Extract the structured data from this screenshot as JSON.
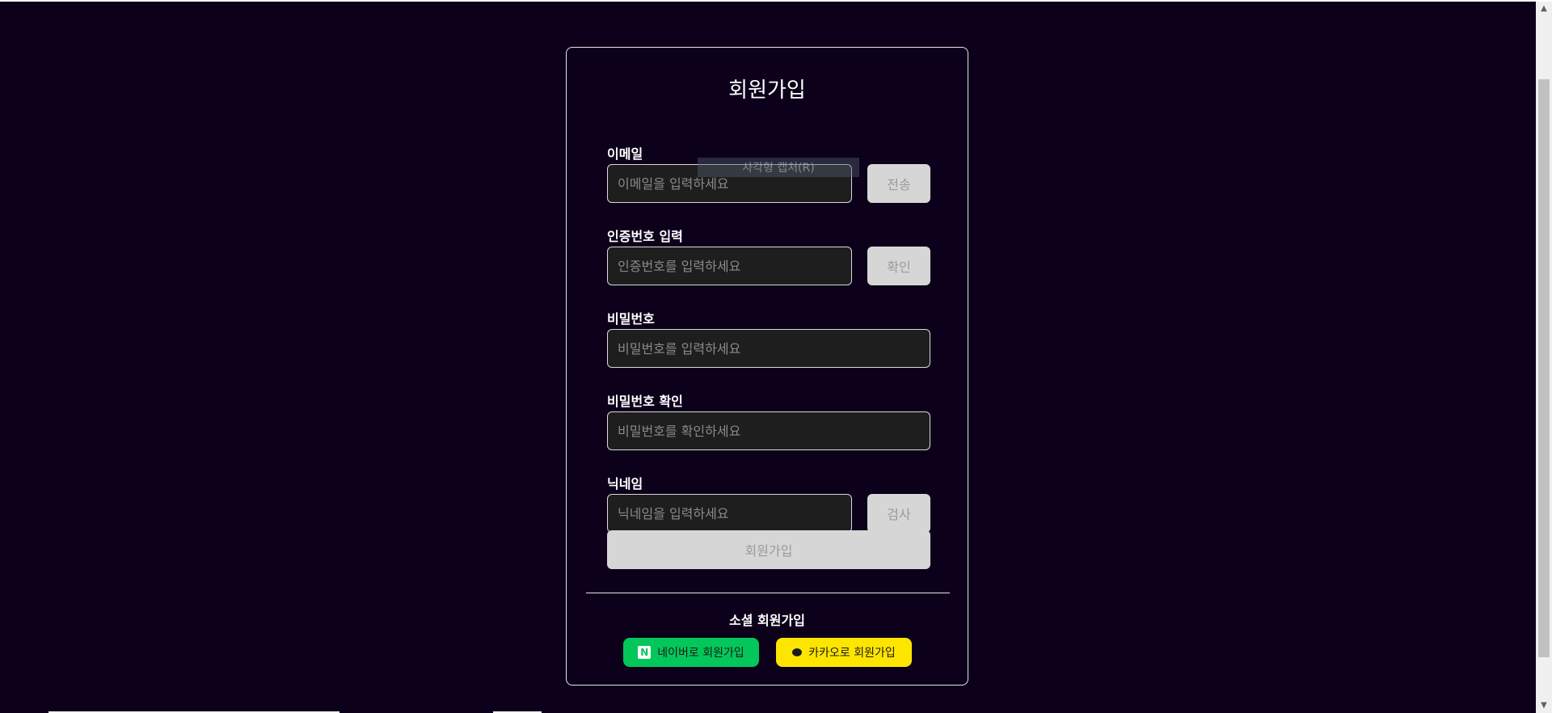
{
  "form": {
    "title": "회원가입",
    "email": {
      "label": "이메일",
      "placeholder": "이메일을 입력하세요",
      "button": "전송"
    },
    "verification": {
      "label": "인증번호 입력",
      "placeholder": "인증번호를 입력하세요",
      "button": "확인"
    },
    "password": {
      "label": "비밀번호",
      "placeholder": "비밀번호를 입력하세요"
    },
    "password_confirm": {
      "label": "비밀번호 확인",
      "placeholder": "비밀번호를 확인하세요"
    },
    "nickname": {
      "label": "닉네임",
      "placeholder": "닉네임을 입력하세요",
      "button": "검사"
    },
    "submit": "회원가입"
  },
  "social": {
    "title": "소셜 회원가입",
    "naver_label": "네이버로 회원가입",
    "naver_icon_text": "N",
    "kakao_label": "카카오로 회원가입"
  },
  "overlay": {
    "tooltip_text": "사각형 캡처(R)"
  },
  "colors": {
    "background": "#0c001b",
    "input_bg": "#1e1e1e",
    "button_disabled": "#d6d6d6",
    "naver": "#03c75a",
    "kakao": "#fee500"
  },
  "icons": [
    "naver-icon",
    "kakao-chat-icon",
    "scroll-up-icon",
    "scroll-down-icon"
  ]
}
